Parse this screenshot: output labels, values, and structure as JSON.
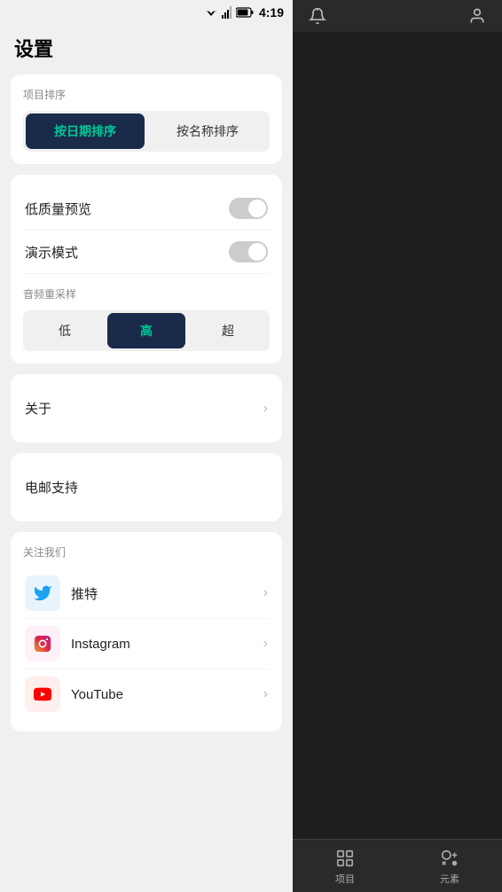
{
  "statusBar": {
    "time": "4:19"
  },
  "pageTitle": "设置",
  "sortSection": {
    "label": "项目排序",
    "buttons": [
      {
        "id": "by-date",
        "label": "按日期排序",
        "active": true
      },
      {
        "id": "by-name",
        "label": "按名称排序",
        "active": false
      }
    ]
  },
  "toggleSection": {
    "items": [
      {
        "id": "low-quality",
        "label": "低质量预览",
        "enabled": false
      },
      {
        "id": "demo-mode",
        "label": "演示模式",
        "enabled": false
      }
    ]
  },
  "audioSection": {
    "label": "音频重采样",
    "buttons": [
      {
        "id": "low",
        "label": "低",
        "active": false
      },
      {
        "id": "high",
        "label": "高",
        "active": true
      },
      {
        "id": "super",
        "label": "超",
        "active": false
      }
    ]
  },
  "menuItems": [
    {
      "id": "about",
      "label": "关于"
    },
    {
      "id": "email-support",
      "label": "电邮支持"
    }
  ],
  "followSection": {
    "label": "关注我们",
    "items": [
      {
        "id": "twitter",
        "name": "推特",
        "icon": "twitter"
      },
      {
        "id": "instagram",
        "name": "Instagram",
        "icon": "instagram"
      },
      {
        "id": "youtube",
        "name": "YouTube",
        "icon": "youtube"
      }
    ]
  },
  "bottomNav": {
    "items": [
      {
        "id": "projects",
        "label": "项目"
      },
      {
        "id": "elements",
        "label": "元素"
      }
    ]
  }
}
